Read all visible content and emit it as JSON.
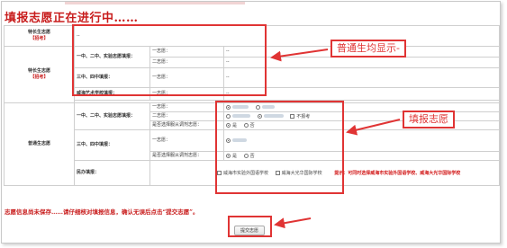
{
  "page_title": "填报志愿正在进行中……",
  "section1": {
    "label": "特长生志愿",
    "sub": "【招考】",
    "value": "--"
  },
  "section2": {
    "label": "特长生志愿",
    "sub": "【招考】",
    "groups": [
      {
        "cat": "一中、二中、实验志愿填报：",
        "rows": [
          {
            "choice": "一志愿：",
            "value": "--"
          },
          {
            "choice": "二志愿：",
            "value": "--"
          }
        ]
      },
      {
        "cat": "三中、四中填报：",
        "rows": [
          {
            "choice": "一志愿：",
            "value": "--"
          }
        ]
      },
      {
        "cat": "威海艺术学校填报：",
        "rows": [
          {
            "choice": "一志愿：",
            "value": "--"
          }
        ]
      }
    ]
  },
  "section3": {
    "label": "普通生志愿",
    "group1": {
      "cat": "一中、二中、实验志愿填报：",
      "row1": {
        "choice": "一志愿："
      },
      "row2": {
        "choice": "二志愿：",
        "extra": "不报考"
      },
      "row3": {
        "choice": "是否选择服从调剂志愿：",
        "yes": "是",
        "no": "否"
      }
    },
    "group2": {
      "cat": "三中、四中填报：",
      "row1": {
        "choice": "一志愿："
      },
      "row2": {
        "choice": "是否选择服从调剂志愿：",
        "yes": "是",
        "no": "否"
      }
    },
    "group3": {
      "cat": "民办填报：",
      "opt1": "威海市实验外国语学校",
      "opt2": "威海大光华国际学校",
      "note": "提示：可同时选择威海市实验外国语学校、威海大光华国际学校"
    }
  },
  "footer_message": "志愿信息尚未保存……请仔细核对填报信息，确认无误后点击“提交志愿”。",
  "submit_label": "提交志愿",
  "callouts": {
    "normal": "普通生均显示-",
    "fill": "填报志愿"
  },
  "colors": {
    "accent_red": "#e03434",
    "title_red": "#c81c1c"
  }
}
